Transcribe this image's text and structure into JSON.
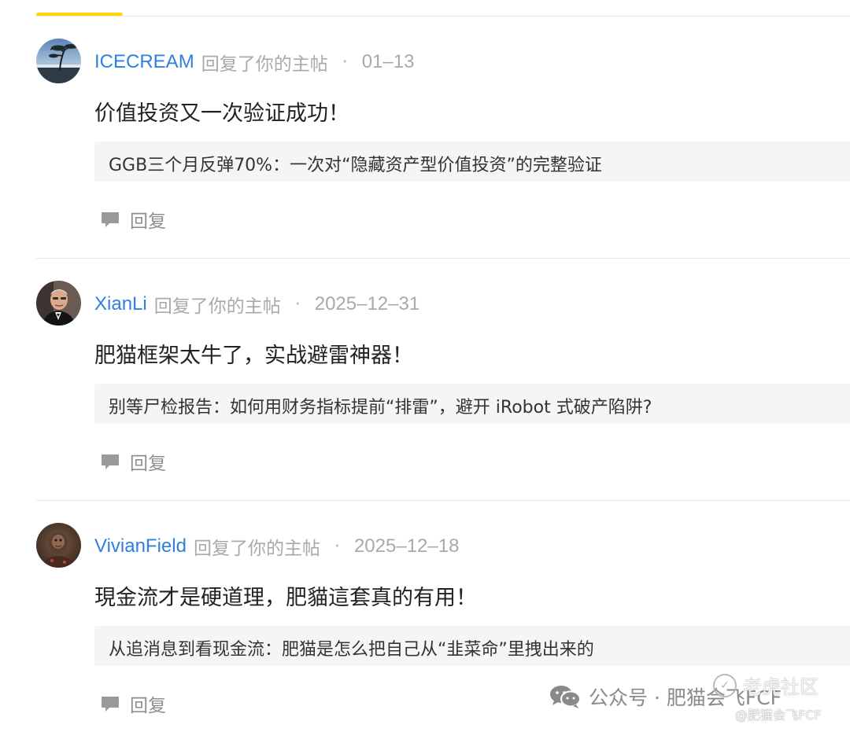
{
  "tabs": {
    "active_indicator_color": "#ffd800"
  },
  "notifications": [
    {
      "username": "ICECREAM",
      "action": "回复了你的主帖",
      "separator": "·",
      "date": "01–13",
      "comment": "价值投资又一次验证成功！",
      "quoted_post": "GGB三个月反弹70%：一次对“隐藏资产型价值投资”的完整验证",
      "reply_label": "回复",
      "avatar_icon": "seaside-tree-avatar"
    },
    {
      "username": "XianLi",
      "action": "回复了你的主帖",
      "separator": "·",
      "date": "2025–12–31",
      "comment": "肥猫框架太牛了，实战避雷神器！",
      "quoted_post": "别等尸检报告：如何用财务指标提前“排雷”，避开 iRobot 式破产陷阱?",
      "reply_label": "回复",
      "avatar_icon": "man-portrait-avatar"
    },
    {
      "username": "VivianField",
      "action": "回复了你的主帖",
      "separator": "·",
      "date": "2025–12–18",
      "comment": "現金流才是硬道理，肥貓這套真的有用！",
      "quoted_post": "从追消息到看现金流：肥猫是怎么把自己从“韭菜命”里拽出来的",
      "reply_label": "回复",
      "avatar_icon": "dark-portrait-avatar"
    }
  ],
  "watermark": {
    "wechat_text": "公众号 · 肥猫会飞FCF",
    "community_name": "老虎社区",
    "community_handle": "@肥猫会飞FCF"
  },
  "colors": {
    "username": "#2f7fe0",
    "muted_text": "#a9a9a9",
    "quote_background": "#f5f5f5",
    "divider": "#e9e9e9"
  }
}
